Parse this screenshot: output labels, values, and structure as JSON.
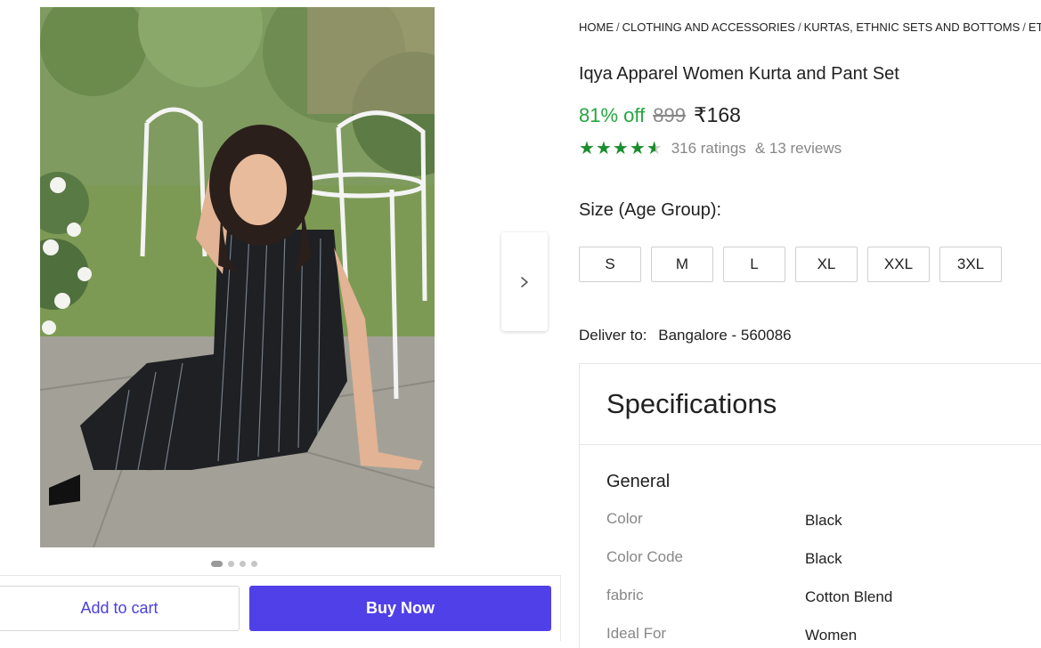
{
  "gallery": {
    "dots": [
      true,
      false,
      false,
      false
    ]
  },
  "actions": {
    "add_to_cart": "Add to cart",
    "buy_now": "Buy Now"
  },
  "breadcrumb": [
    "HOME",
    "CLOTHING AND ACCESSORIES",
    "KURTAS, ETHNIC SETS AND BOTTOMS",
    "ETHNIC"
  ],
  "product": {
    "title": "Iqya Apparel Women Kurta and Pant Set",
    "discount": "81% off",
    "mrp": "899",
    "price": "₹168",
    "rating_value": 4.5,
    "ratings_text": "316 ratings",
    "reviews_text": "& 13 reviews"
  },
  "size": {
    "label": "Size (Age Group):",
    "options": [
      "S",
      "M",
      "L",
      "XL",
      "XXL",
      "3XL"
    ]
  },
  "delivery": {
    "label": "Deliver to:",
    "location": "Bangalore - 560086"
  },
  "specifications": {
    "title": "Specifications",
    "section": "General",
    "rows": [
      {
        "key": "Color",
        "value": "Black"
      },
      {
        "key": "Color Code",
        "value": "Black"
      },
      {
        "key": "fabric",
        "value": "Cotton Blend"
      },
      {
        "key": "Ideal For",
        "value": "Women"
      }
    ]
  },
  "colors": {
    "accent": "#5040e8",
    "discount": "#26a541",
    "star": "#1a8d2c"
  }
}
